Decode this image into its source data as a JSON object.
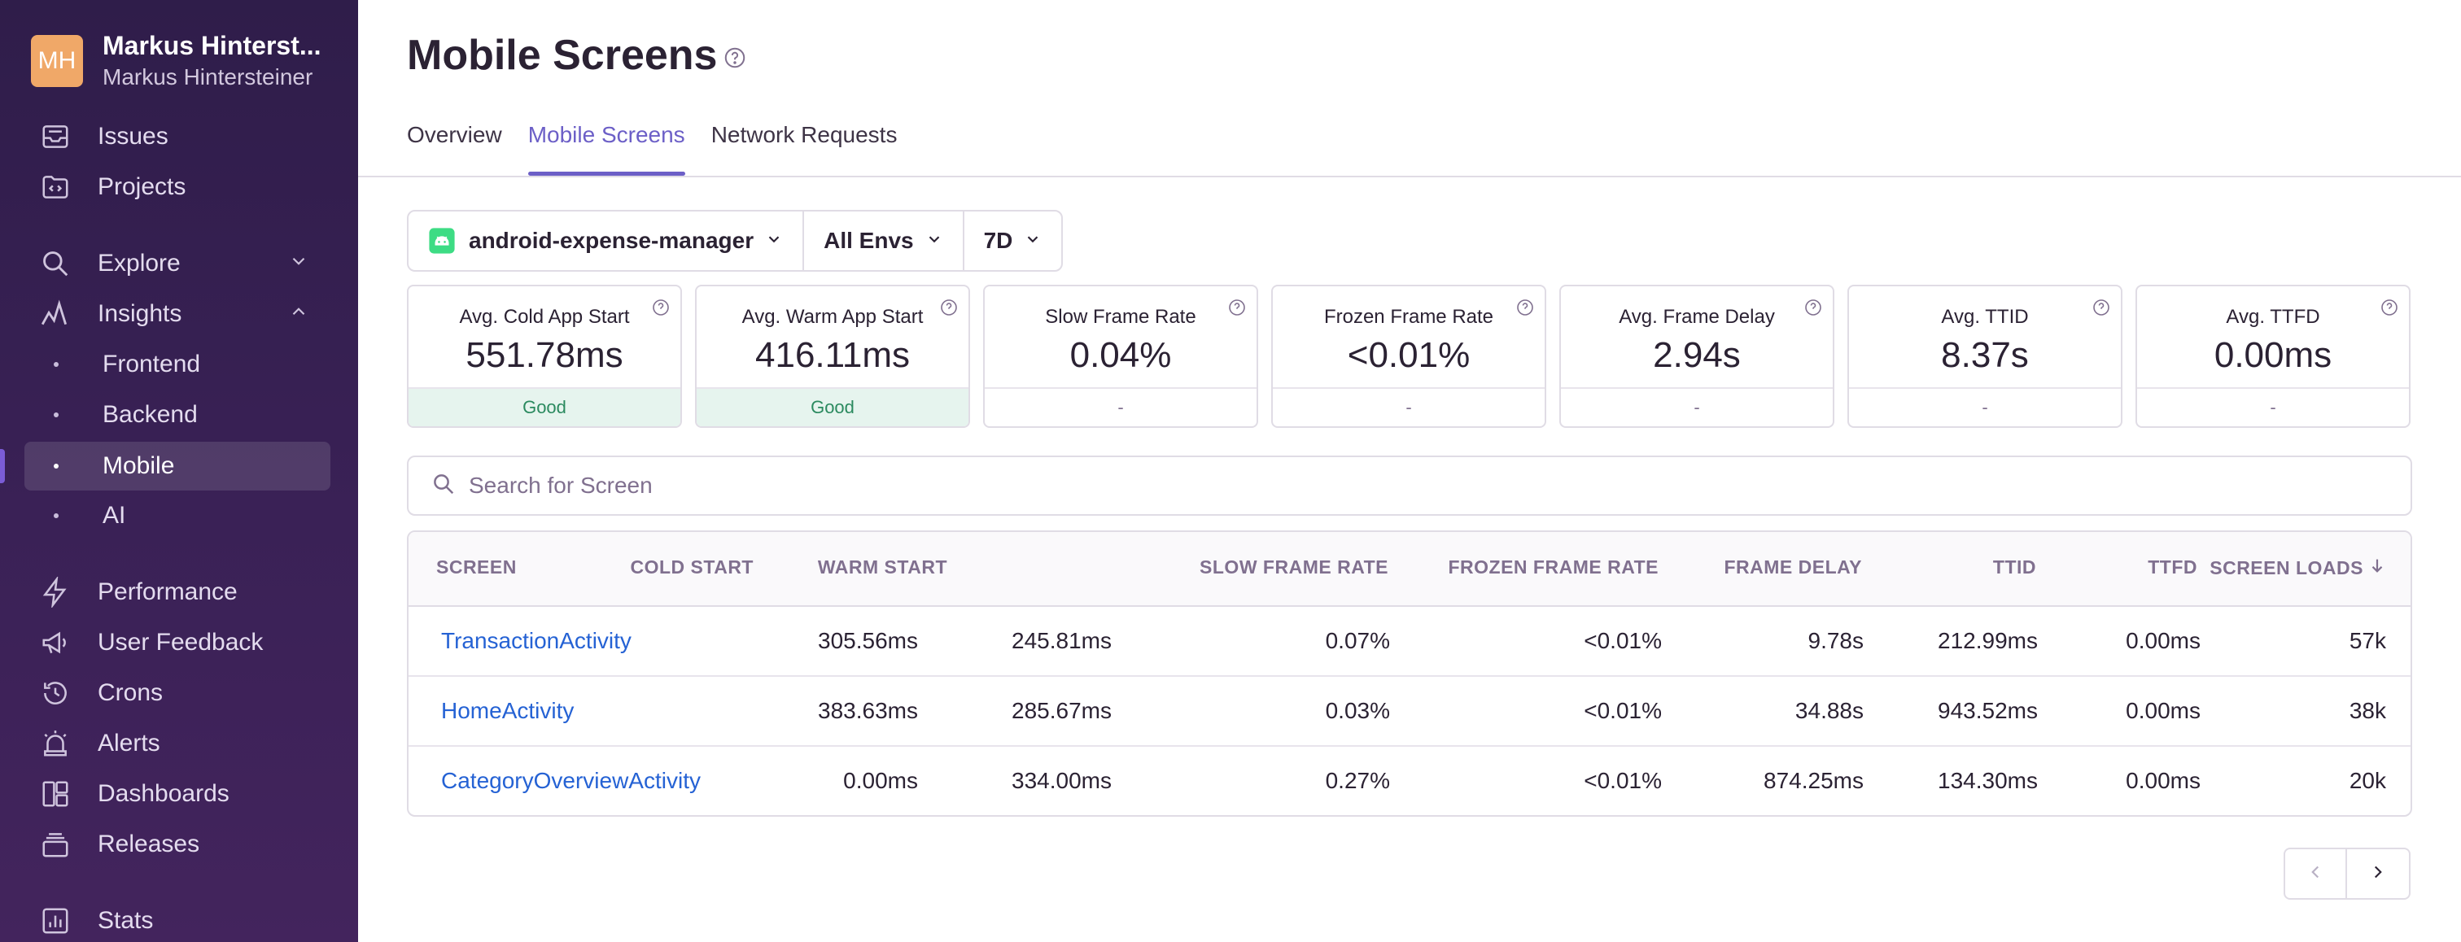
{
  "org": {
    "initials": "MH",
    "name": "Markus Hinterst...",
    "sub": "Markus Hintersteiner"
  },
  "nav": {
    "issues": "Issues",
    "projects": "Projects",
    "explore": "Explore",
    "insights": "Insights",
    "frontend": "Frontend",
    "backend": "Backend",
    "mobile": "Mobile",
    "ai": "AI",
    "performance": "Performance",
    "user_feedback": "User Feedback",
    "crons": "Crons",
    "alerts": "Alerts",
    "dashboards": "Dashboards",
    "releases": "Releases",
    "stats": "Stats"
  },
  "page": {
    "title": "Mobile Screens"
  },
  "tabs": [
    "Overview",
    "Mobile Screens",
    "Network Requests"
  ],
  "filters": {
    "project": "android-expense-manager",
    "env": "All Envs",
    "period": "7D"
  },
  "cards": [
    {
      "title": "Avg. Cold App Start",
      "value": "551.78ms",
      "foot": "Good"
    },
    {
      "title": "Avg. Warm App Start",
      "value": "416.11ms",
      "foot": "Good"
    },
    {
      "title": "Slow Frame Rate",
      "value": "0.04%",
      "foot": "-"
    },
    {
      "title": "Frozen Frame Rate",
      "value": "<0.01%",
      "foot": "-"
    },
    {
      "title": "Avg. Frame Delay",
      "value": "2.94s",
      "foot": "-"
    },
    {
      "title": "Avg. TTID",
      "value": "8.37s",
      "foot": "-"
    },
    {
      "title": "Avg. TTFD",
      "value": "0.00ms",
      "foot": "-"
    }
  ],
  "search": {
    "placeholder": "Search for Screen"
  },
  "table": {
    "headers": [
      "SCREEN",
      "COLD START",
      "WARM START",
      "SLOW FRAME RATE",
      "FROZEN FRAME RATE",
      "FRAME DELAY",
      "TTID",
      "TTFD",
      "SCREEN LOADS"
    ],
    "rows": [
      [
        "TransactionActivity",
        "305.56ms",
        "245.81ms",
        "0.07%",
        "<0.01%",
        "9.78s",
        "212.99ms",
        "0.00ms",
        "57k"
      ],
      [
        "HomeActivity",
        "383.63ms",
        "285.67ms",
        "0.03%",
        "<0.01%",
        "34.88s",
        "943.52ms",
        "0.00ms",
        "38k"
      ],
      [
        "CategoryOverviewActivity",
        "0.00ms",
        "334.00ms",
        "0.27%",
        "<0.01%",
        "874.25ms",
        "134.30ms",
        "0.00ms",
        "20k"
      ]
    ]
  }
}
